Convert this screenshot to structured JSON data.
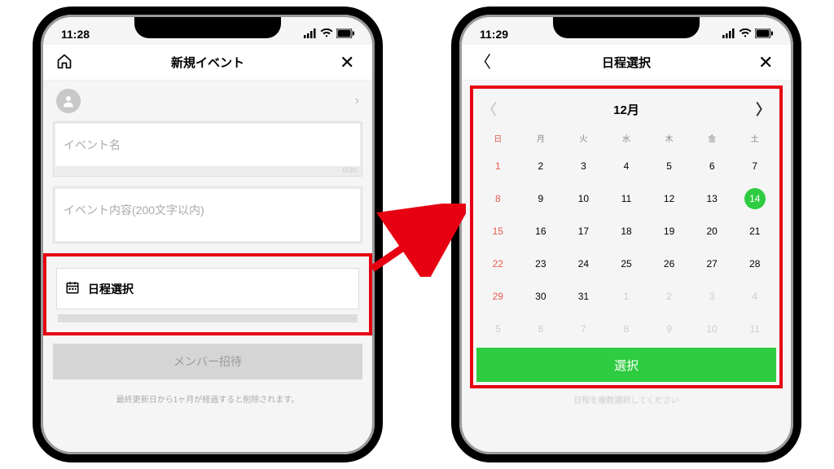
{
  "left_phone": {
    "status_time": "11:28",
    "nav_title": "新規イベント",
    "event_name_placeholder": "イベント名",
    "event_name_counter": "0/30",
    "event_desc_placeholder": "イベント内容(200文字以内)",
    "date_select_label": "日程選択",
    "member_invite_label": "メンバー招待",
    "footnote": "最終更新日から1ヶ月が経過すると削除されます。"
  },
  "right_phone": {
    "status_time": "11:29",
    "nav_title": "日程選択",
    "month_label": "12月",
    "dow": [
      "日",
      "月",
      "火",
      "水",
      "木",
      "金",
      "土"
    ],
    "weeks": [
      [
        {
          "d": "1",
          "sun": true
        },
        {
          "d": "2"
        },
        {
          "d": "3"
        },
        {
          "d": "4"
        },
        {
          "d": "5"
        },
        {
          "d": "6"
        },
        {
          "d": "7"
        }
      ],
      [
        {
          "d": "8",
          "sun": true
        },
        {
          "d": "9"
        },
        {
          "d": "10"
        },
        {
          "d": "11"
        },
        {
          "d": "12"
        },
        {
          "d": "13"
        },
        {
          "d": "14",
          "selected": true
        }
      ],
      [
        {
          "d": "15",
          "sun": true
        },
        {
          "d": "16"
        },
        {
          "d": "17"
        },
        {
          "d": "18"
        },
        {
          "d": "19"
        },
        {
          "d": "20"
        },
        {
          "d": "21"
        }
      ],
      [
        {
          "d": "22",
          "sun": true
        },
        {
          "d": "23"
        },
        {
          "d": "24"
        },
        {
          "d": "25"
        },
        {
          "d": "26"
        },
        {
          "d": "27"
        },
        {
          "d": "28"
        }
      ],
      [
        {
          "d": "29",
          "sun": true
        },
        {
          "d": "30"
        },
        {
          "d": "31"
        },
        {
          "d": "1",
          "dim": true
        },
        {
          "d": "2",
          "dim": true
        },
        {
          "d": "3",
          "dim": true
        },
        {
          "d": "4",
          "dim": true
        }
      ],
      [
        {
          "d": "5",
          "dim": true,
          "sun": true
        },
        {
          "d": "6",
          "dim": true
        },
        {
          "d": "7",
          "dim": true
        },
        {
          "d": "8",
          "dim": true
        },
        {
          "d": "9",
          "dim": true
        },
        {
          "d": "10",
          "dim": true
        },
        {
          "d": "11",
          "dim": true
        }
      ]
    ],
    "selected_day": "14",
    "select_button": "選択",
    "hint_text": "日程を複数選択してください"
  }
}
